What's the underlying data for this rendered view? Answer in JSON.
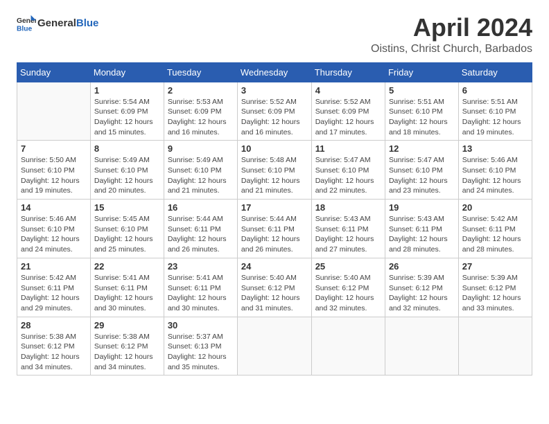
{
  "logo": {
    "general": "General",
    "blue": "Blue"
  },
  "header": {
    "month": "April 2024",
    "location": "Oistins, Christ Church, Barbados"
  },
  "weekdays": [
    "Sunday",
    "Monday",
    "Tuesday",
    "Wednesday",
    "Thursday",
    "Friday",
    "Saturday"
  ],
  "weeks": [
    [
      {
        "day": "",
        "sunrise": "",
        "sunset": "",
        "daylight": ""
      },
      {
        "day": "1",
        "sunrise": "Sunrise: 5:54 AM",
        "sunset": "Sunset: 6:09 PM",
        "daylight": "Daylight: 12 hours and 15 minutes."
      },
      {
        "day": "2",
        "sunrise": "Sunrise: 5:53 AM",
        "sunset": "Sunset: 6:09 PM",
        "daylight": "Daylight: 12 hours and 16 minutes."
      },
      {
        "day": "3",
        "sunrise": "Sunrise: 5:52 AM",
        "sunset": "Sunset: 6:09 PM",
        "daylight": "Daylight: 12 hours and 16 minutes."
      },
      {
        "day": "4",
        "sunrise": "Sunrise: 5:52 AM",
        "sunset": "Sunset: 6:09 PM",
        "daylight": "Daylight: 12 hours and 17 minutes."
      },
      {
        "day": "5",
        "sunrise": "Sunrise: 5:51 AM",
        "sunset": "Sunset: 6:10 PM",
        "daylight": "Daylight: 12 hours and 18 minutes."
      },
      {
        "day": "6",
        "sunrise": "Sunrise: 5:51 AM",
        "sunset": "Sunset: 6:10 PM",
        "daylight": "Daylight: 12 hours and 19 minutes."
      }
    ],
    [
      {
        "day": "7",
        "sunrise": "Sunrise: 5:50 AM",
        "sunset": "Sunset: 6:10 PM",
        "daylight": "Daylight: 12 hours and 19 minutes."
      },
      {
        "day": "8",
        "sunrise": "Sunrise: 5:49 AM",
        "sunset": "Sunset: 6:10 PM",
        "daylight": "Daylight: 12 hours and 20 minutes."
      },
      {
        "day": "9",
        "sunrise": "Sunrise: 5:49 AM",
        "sunset": "Sunset: 6:10 PM",
        "daylight": "Daylight: 12 hours and 21 minutes."
      },
      {
        "day": "10",
        "sunrise": "Sunrise: 5:48 AM",
        "sunset": "Sunset: 6:10 PM",
        "daylight": "Daylight: 12 hours and 21 minutes."
      },
      {
        "day": "11",
        "sunrise": "Sunrise: 5:47 AM",
        "sunset": "Sunset: 6:10 PM",
        "daylight": "Daylight: 12 hours and 22 minutes."
      },
      {
        "day": "12",
        "sunrise": "Sunrise: 5:47 AM",
        "sunset": "Sunset: 6:10 PM",
        "daylight": "Daylight: 12 hours and 23 minutes."
      },
      {
        "day": "13",
        "sunrise": "Sunrise: 5:46 AM",
        "sunset": "Sunset: 6:10 PM",
        "daylight": "Daylight: 12 hours and 24 minutes."
      }
    ],
    [
      {
        "day": "14",
        "sunrise": "Sunrise: 5:46 AM",
        "sunset": "Sunset: 6:10 PM",
        "daylight": "Daylight: 12 hours and 24 minutes."
      },
      {
        "day": "15",
        "sunrise": "Sunrise: 5:45 AM",
        "sunset": "Sunset: 6:10 PM",
        "daylight": "Daylight: 12 hours and 25 minutes."
      },
      {
        "day": "16",
        "sunrise": "Sunrise: 5:44 AM",
        "sunset": "Sunset: 6:11 PM",
        "daylight": "Daylight: 12 hours and 26 minutes."
      },
      {
        "day": "17",
        "sunrise": "Sunrise: 5:44 AM",
        "sunset": "Sunset: 6:11 PM",
        "daylight": "Daylight: 12 hours and 26 minutes."
      },
      {
        "day": "18",
        "sunrise": "Sunrise: 5:43 AM",
        "sunset": "Sunset: 6:11 PM",
        "daylight": "Daylight: 12 hours and 27 minutes."
      },
      {
        "day": "19",
        "sunrise": "Sunrise: 5:43 AM",
        "sunset": "Sunset: 6:11 PM",
        "daylight": "Daylight: 12 hours and 28 minutes."
      },
      {
        "day": "20",
        "sunrise": "Sunrise: 5:42 AM",
        "sunset": "Sunset: 6:11 PM",
        "daylight": "Daylight: 12 hours and 28 minutes."
      }
    ],
    [
      {
        "day": "21",
        "sunrise": "Sunrise: 5:42 AM",
        "sunset": "Sunset: 6:11 PM",
        "daylight": "Daylight: 12 hours and 29 minutes."
      },
      {
        "day": "22",
        "sunrise": "Sunrise: 5:41 AM",
        "sunset": "Sunset: 6:11 PM",
        "daylight": "Daylight: 12 hours and 30 minutes."
      },
      {
        "day": "23",
        "sunrise": "Sunrise: 5:41 AM",
        "sunset": "Sunset: 6:11 PM",
        "daylight": "Daylight: 12 hours and 30 minutes."
      },
      {
        "day": "24",
        "sunrise": "Sunrise: 5:40 AM",
        "sunset": "Sunset: 6:12 PM",
        "daylight": "Daylight: 12 hours and 31 minutes."
      },
      {
        "day": "25",
        "sunrise": "Sunrise: 5:40 AM",
        "sunset": "Sunset: 6:12 PM",
        "daylight": "Daylight: 12 hours and 32 minutes."
      },
      {
        "day": "26",
        "sunrise": "Sunrise: 5:39 AM",
        "sunset": "Sunset: 6:12 PM",
        "daylight": "Daylight: 12 hours and 32 minutes."
      },
      {
        "day": "27",
        "sunrise": "Sunrise: 5:39 AM",
        "sunset": "Sunset: 6:12 PM",
        "daylight": "Daylight: 12 hours and 33 minutes."
      }
    ],
    [
      {
        "day": "28",
        "sunrise": "Sunrise: 5:38 AM",
        "sunset": "Sunset: 6:12 PM",
        "daylight": "Daylight: 12 hours and 34 minutes."
      },
      {
        "day": "29",
        "sunrise": "Sunrise: 5:38 AM",
        "sunset": "Sunset: 6:12 PM",
        "daylight": "Daylight: 12 hours and 34 minutes."
      },
      {
        "day": "30",
        "sunrise": "Sunrise: 5:37 AM",
        "sunset": "Sunset: 6:13 PM",
        "daylight": "Daylight: 12 hours and 35 minutes."
      },
      {
        "day": "",
        "sunrise": "",
        "sunset": "",
        "daylight": ""
      },
      {
        "day": "",
        "sunrise": "",
        "sunset": "",
        "daylight": ""
      },
      {
        "day": "",
        "sunrise": "",
        "sunset": "",
        "daylight": ""
      },
      {
        "day": "",
        "sunrise": "",
        "sunset": "",
        "daylight": ""
      }
    ]
  ]
}
